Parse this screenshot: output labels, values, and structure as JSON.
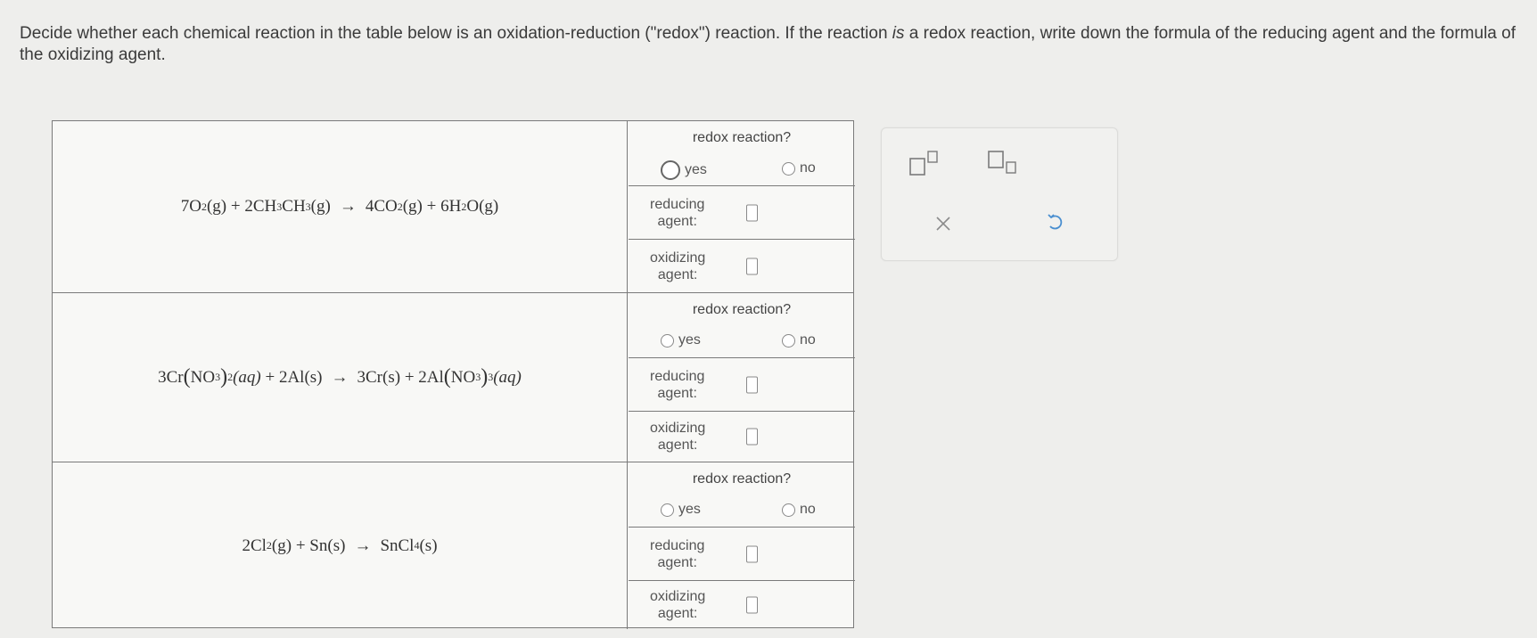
{
  "instructions": {
    "part1": "Decide whether each chemical reaction in the table below is an oxidation-reduction (\"redox\") reaction. If the reaction ",
    "em": "is",
    "part2": " a redox reaction, write down the formula of the reducing agent and the formula of the oxidizing agent."
  },
  "question_label": "redox reaction?",
  "yes_label": "yes",
  "no_label": "no",
  "reducing_label": [
    "reducing",
    "agent:"
  ],
  "oxidizing_label": [
    "oxidizing",
    "agent:"
  ],
  "reactions": [
    {
      "coef1": "7O",
      "sub1": "2",
      "state1": "(g)",
      "plus1": "+",
      "coef2": "2CH",
      "sub2a": "3",
      "mid2": "CH",
      "sub2b": "3",
      "state2": "(g)",
      "arrow": "→",
      "coef3": "4CO",
      "sub3": "2",
      "state3": "(g)",
      "plus2": "+",
      "coef4": "6H",
      "sub4": "2",
      "tail4": "O",
      "state4": "(g)"
    },
    {
      "a1": "3Cr",
      "lp1": "(",
      "n1": "NO",
      "s1": "3",
      "rp1": ")",
      "s1b": "2",
      "st1": "(aq)",
      "plus1": "+",
      "a2": "2Al",
      "st2": "(s)",
      "arrow": "→",
      "a3": "3Cr",
      "st3": "(s)",
      "plus2": "+",
      "a4": "2Al",
      "lp4": "(",
      "n4": "NO",
      "s4": "3",
      "rp4": ")",
      "s4b": "3",
      "st4": "(aq)"
    },
    {
      "a1": "2Cl",
      "s1": "2",
      "st1": "(g)",
      "plus1": "+",
      "a2": "Sn",
      "st2": "(s)",
      "arrow": "→",
      "a3": "SnCl",
      "s3": "4",
      "st3": "(s)"
    }
  ],
  "answers": [
    {
      "selected": "yes"
    },
    {
      "selected": null
    },
    {
      "selected": null
    }
  ],
  "toolbar": {
    "superscript_icon": "superscript-icon",
    "subscript_icon": "subscript-icon",
    "clear_icon": "clear-icon",
    "undo_icon": "undo-icon"
  },
  "colors": {
    "background": "#eeeeec",
    "accent_undo": "#4a8fd0",
    "border": "#7a7a7a"
  }
}
